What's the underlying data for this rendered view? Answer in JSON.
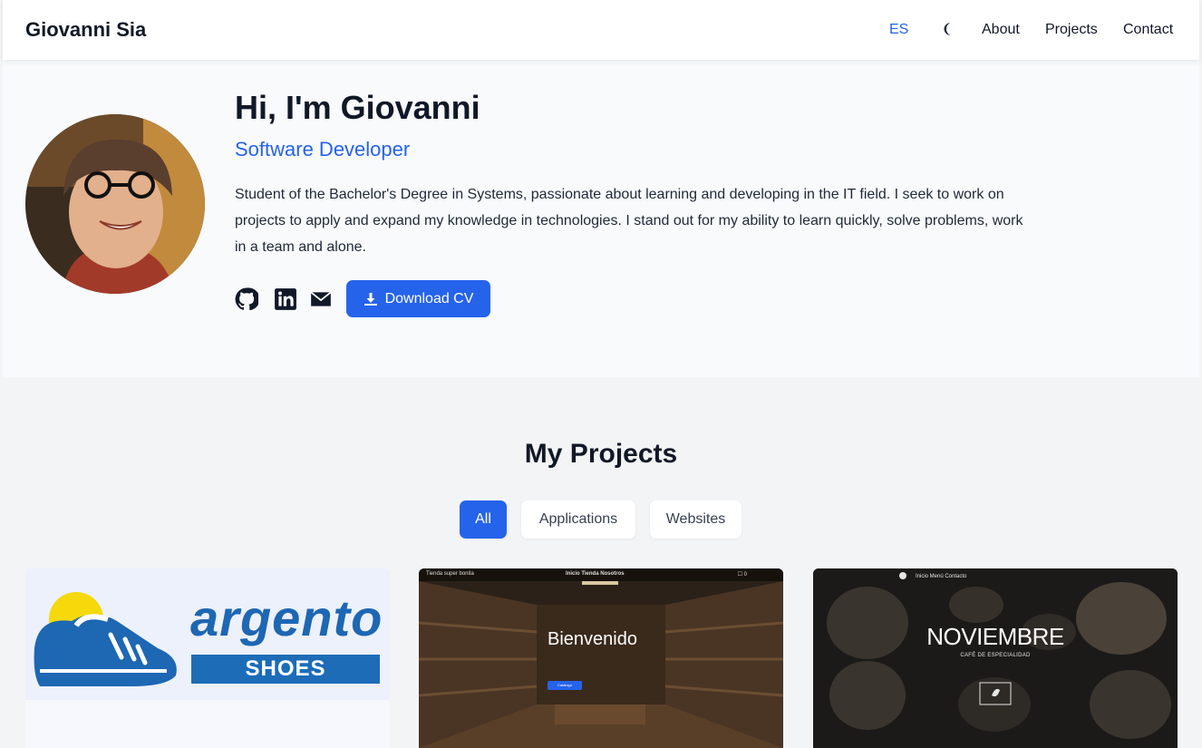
{
  "nav": {
    "brand": "Giovanni Sia",
    "lang": "ES",
    "links": [
      "About",
      "Projects",
      "Contact"
    ]
  },
  "hero": {
    "title": "Hi, I'm Giovanni",
    "role": "Software Developer",
    "bio": "Student of the Bachelor's Degree in Systems, passionate about learning and developing in the IT field. I seek to work on projects to apply and expand my knowledge in technologies. I stand out for my ability to learn quickly, solve problems, work in a team and alone.",
    "cv_label": "Download CV",
    "social_icons": [
      "github-icon",
      "linkedin-icon",
      "envelope-icon"
    ]
  },
  "projects": {
    "title": "My Projects",
    "filters": [
      "All",
      "Applications",
      "Websites"
    ],
    "active_filter": "All",
    "cards": [
      {
        "logo_word": "argento",
        "logo_bar": "SHOES"
      },
      {
        "brand": "Tienda super bonita",
        "nav": "Inicio  Tienda  Nosotros",
        "cart": "☐ 0",
        "title": "Bienvenido",
        "button": "Catálogo"
      },
      {
        "nav": "Inicio   Menú   Contacto",
        "title": "NOVIEMBRE",
        "subtitle": "CAFÉ DE ESPECIALIDAD"
      }
    ]
  },
  "colors": {
    "accent": "#2563eb",
    "text": "#111827",
    "hero_bg": "#f8fafc",
    "section_bg": "#f3f4f6"
  }
}
